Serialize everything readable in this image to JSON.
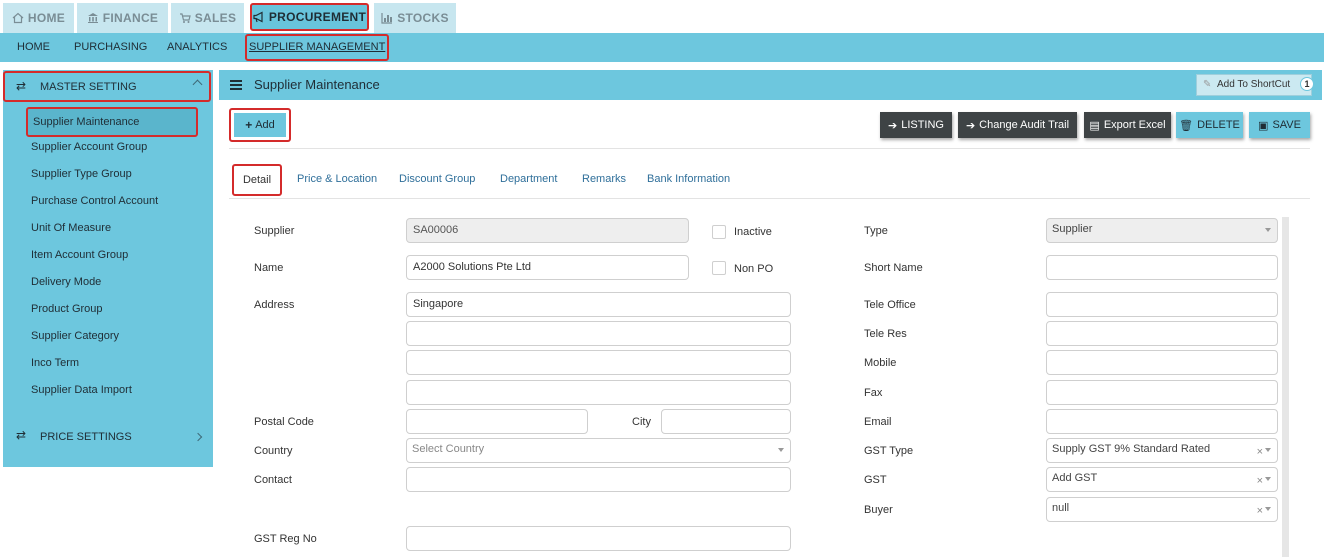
{
  "top_tabs": [
    {
      "label": "HOME",
      "icon": "home-icon"
    },
    {
      "label": "FINANCE",
      "icon": "bank-icon"
    },
    {
      "label": "SALES",
      "icon": "cart-icon"
    },
    {
      "label": "PROCUREMENT",
      "icon": "megaphone-icon"
    },
    {
      "label": "STOCKS",
      "icon": "bar-chart-icon"
    }
  ],
  "sub_nav": [
    "HOME",
    "PURCHASING",
    "ANALYTICS",
    "SUPPLIER MANAGEMENT"
  ],
  "sidebar": {
    "section1": "MASTER SETTING",
    "items": [
      "Supplier Maintenance",
      "Supplier Account Group",
      "Supplier Type Group",
      "Purchase Control Account",
      "Unit Of Measure",
      "Item Account Group",
      "Delivery Mode",
      "Product Group",
      "Supplier Category",
      "Inco Term",
      "Supplier Data Import"
    ],
    "section2": "PRICE SETTINGS"
  },
  "main": {
    "title": "Supplier Maintenance",
    "shortcut": "Add To ShortCut",
    "shortcut_count": "1",
    "add_label": "Add",
    "actions": {
      "listing": "LISTING",
      "audit": "Change Audit Trail",
      "export": "Export Excel",
      "delete": "DELETE",
      "save": "SAVE"
    },
    "tabs": [
      "Detail",
      "Price & Location",
      "Discount Group",
      "Department",
      "Remarks",
      "Bank Information"
    ]
  },
  "form": {
    "supplier_label": "Supplier",
    "supplier_value": "SA00006",
    "inactive_label": "Inactive",
    "name_label": "Name",
    "name_value": "A2000 Solutions Pte Ltd",
    "nonpo_label": "Non PO",
    "address_label": "Address",
    "address1": "Singapore",
    "postal_label": "Postal Code",
    "city_label": "City",
    "country_label": "Country",
    "country_placeholder": "Select Country",
    "contact_label": "Contact",
    "gstreg_label": "GST Reg No",
    "type_label": "Type",
    "type_value": "Supplier",
    "shortname_label": "Short Name",
    "teleoffice_label": "Tele Office",
    "teleres_label": "Tele Res",
    "mobile_label": "Mobile",
    "fax_label": "Fax",
    "email_label": "Email",
    "gsttype_label": "GST Type",
    "gsttype_value": "Supply GST 9% Standard Rated",
    "gst_label": "GST",
    "gst_value": "Add GST",
    "buyer_label": "Buyer",
    "buyer_value": "null"
  }
}
